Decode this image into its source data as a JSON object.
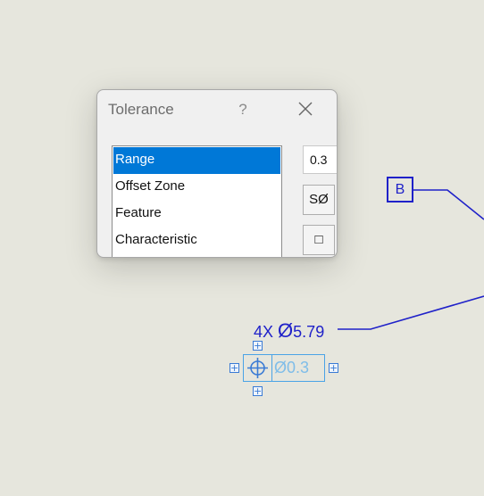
{
  "dialog": {
    "title": "Tolerance",
    "help_label": "?",
    "close_label": "✕",
    "list_items": [
      {
        "label": "Range",
        "selected": true
      },
      {
        "label": "Offset Zone",
        "selected": false
      },
      {
        "label": "Feature",
        "selected": false
      },
      {
        "label": "Characteristic",
        "selected": false
      }
    ],
    "value": "0.3",
    "spherical_diameter_label": "SØ",
    "square_label": "□"
  },
  "drawing": {
    "datum_label": "B",
    "dimension": {
      "count": "4X",
      "diameter_symbol": "Ø",
      "value": "5.79"
    },
    "feature_control_frame": {
      "tolerance": "Ø0.3",
      "symbol": "position-icon"
    },
    "handle_label": "+"
  },
  "colors": {
    "annotation_blue": "#1f21c9",
    "selection_blue": "#0078d7",
    "frame_blue": "#4aa3e6",
    "background": "#e6e6dd"
  }
}
